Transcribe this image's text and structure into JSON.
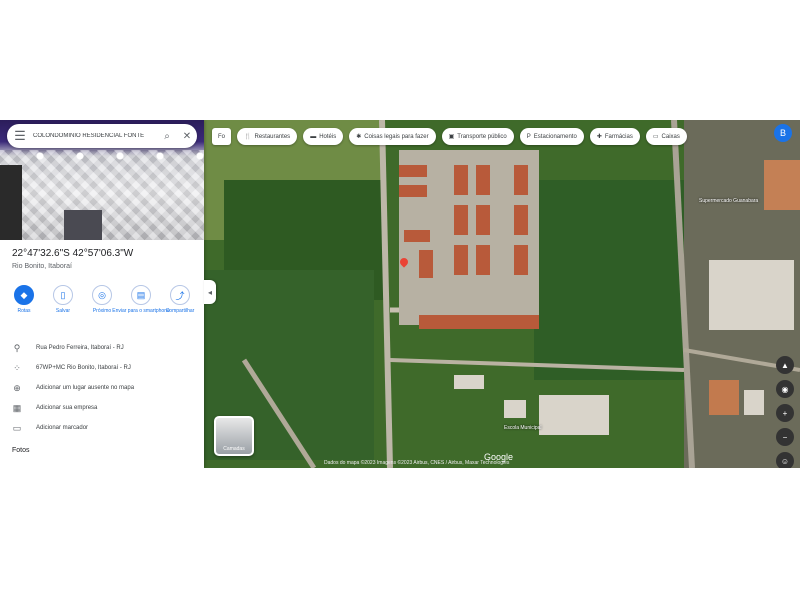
{
  "search": {
    "query": "COLONDOMINIO RESIDENCIAL FONTE"
  },
  "place": {
    "coordinates": "22°47'32.6\"S 42°57'06.3\"W",
    "subtitle": "Rio Bonito, Itaboraí"
  },
  "actions": [
    {
      "label": "Rotas",
      "icon": "directions-icon"
    },
    {
      "label": "Salvar",
      "icon": "bookmark-icon"
    },
    {
      "label": "Próximo",
      "icon": "nearby-icon"
    },
    {
      "label": "Enviar para o smartphone",
      "icon": "phone-icon"
    },
    {
      "label": "Compartilhar",
      "icon": "share-icon"
    }
  ],
  "info_rows": [
    {
      "icon": "location-pin-icon",
      "text": "Rua Pedro Ferreira, Itaboraí - RJ"
    },
    {
      "icon": "plus-code-icon",
      "text": "67WP+MC Rio Bonito, Itaboraí - RJ"
    },
    {
      "icon": "add-place-icon",
      "text": "Adicionar um lugar ausente no mapa"
    },
    {
      "icon": "business-icon",
      "text": "Adicionar sua empresa"
    },
    {
      "icon": "label-icon",
      "text": "Adicionar marcador"
    }
  ],
  "section_title": "Fotos",
  "chips": [
    {
      "label": "Restaurantes",
      "icon": "restaurant-icon"
    },
    {
      "label": "Hotéis",
      "icon": "hotel-icon"
    },
    {
      "label": "Coisas legais para fazer",
      "icon": "attraction-icon"
    },
    {
      "label": "Transporte público",
      "icon": "transit-icon"
    },
    {
      "label": "Estacionamento",
      "icon": "parking-icon"
    },
    {
      "label": "Farmácias",
      "icon": "pharmacy-icon"
    },
    {
      "label": "Caixas",
      "icon": "atm-icon"
    }
  ],
  "chip_prefix": "Fo",
  "avatar_letter": "B",
  "layers_label": "Camadas",
  "map_attribution": "Dados do mapa ©2023 Imagens ©2023 Airbus, CNES / Airbus, Maxar Technologies",
  "map_logo": "Google",
  "place_labels": [
    "Supermercado Guanabara",
    "Escola Municipal"
  ],
  "colors": {
    "accent": "#1a73e8",
    "pin": "#ea4335"
  }
}
